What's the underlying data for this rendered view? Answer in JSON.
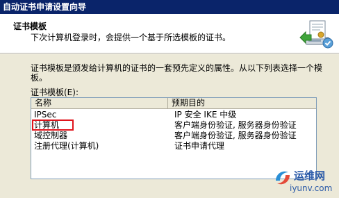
{
  "window": {
    "title": "自动证书申请设置向导"
  },
  "header": {
    "title": "证书模板",
    "subtitle": "下次计算机登录时，会提供一个基于所选模板的证书。"
  },
  "body": {
    "description": "证书模板是颁发给计算机的证书的一套预先定义的属性。从以下列表选择一个模板。",
    "list_label": "证书模板(E):"
  },
  "listview": {
    "columns": [
      "名称",
      "预期目的"
    ],
    "rows": [
      {
        "name": "IPSec",
        "purpose": "IP 安全 IKE 中级"
      },
      {
        "name": "计算机",
        "purpose": "客户端身份验证, 服务器身份验证"
      },
      {
        "name": "域控制器",
        "purpose": "客户端身份验证, 服务器身份验证"
      },
      {
        "name": "注册代理(计算机)",
        "purpose": "证书申请代理"
      }
    ],
    "selected_index": 1
  },
  "watermark": {
    "text_cn": "运维网",
    "text_en": "iyunv.com"
  },
  "colors": {
    "titlebar": "#0a246a",
    "highlight_border": "#e0141c",
    "watermark": "#2a5aa8"
  }
}
